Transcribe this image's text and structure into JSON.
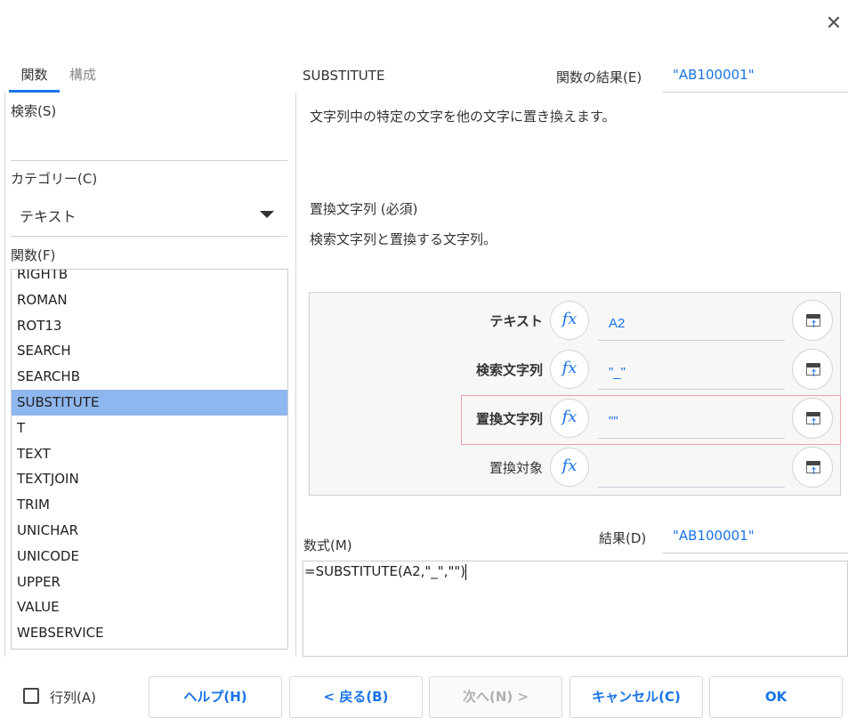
{
  "dialog": {
    "close_glyph": "✕"
  },
  "tabs": [
    {
      "label": "関数",
      "active": true
    },
    {
      "label": "構成",
      "active": false
    }
  ],
  "left": {
    "search_label": "検索(S)",
    "search_value": "",
    "category_label": "カテゴリー(C)",
    "category_value": "テキスト",
    "functions_label": "関数(F)",
    "functions": [
      "RIGHTB",
      "ROMAN",
      "ROT13",
      "SEARCH",
      "SEARCHB",
      "SUBSTITUTE",
      "T",
      "TEXT",
      "TEXTJOIN",
      "TRIM",
      "UNICHAR",
      "UNICODE",
      "UPPER",
      "VALUE",
      "WEBSERVICE"
    ],
    "selected_function": "SUBSTITUTE"
  },
  "right": {
    "function_name": "SUBSTITUTE",
    "function_result_label": "関数の結果(E)",
    "function_result_value": "\"AB100001\"",
    "description": "文字列中の特定の文字を他の文字に置き換えます。",
    "param_name": "置換文字列 (必須)",
    "param_description": "検索文字列と置換する文字列。",
    "arguments": [
      {
        "label": "テキスト",
        "value": "A2",
        "bold": true
      },
      {
        "label": "検索文字列",
        "value": "\"_\"",
        "bold": true
      },
      {
        "label": "置換文字列",
        "value": "\"\"",
        "bold": true,
        "active": true
      },
      {
        "label": "置換対象",
        "value": "",
        "bold": false
      }
    ],
    "fx_glyph": "fx",
    "formula_label": "数式(M)",
    "result_label": "結果(D)",
    "result_value": "\"AB100001\"",
    "formula": "=SUBSTITUTE(A2,\"_\",\"\")"
  },
  "footer": {
    "array_label": "行列(A)",
    "array_checked": false,
    "buttons": {
      "help": "ヘルプ(H)",
      "back": "< 戻る(B)",
      "next": "次へ(N) >",
      "cancel": "キャンセル(C)",
      "ok": "OK"
    }
  },
  "colors": {
    "accent": "#1a73e8",
    "selected_row": "#8fb7ef",
    "active_arg_border": "#e8a5a5"
  }
}
